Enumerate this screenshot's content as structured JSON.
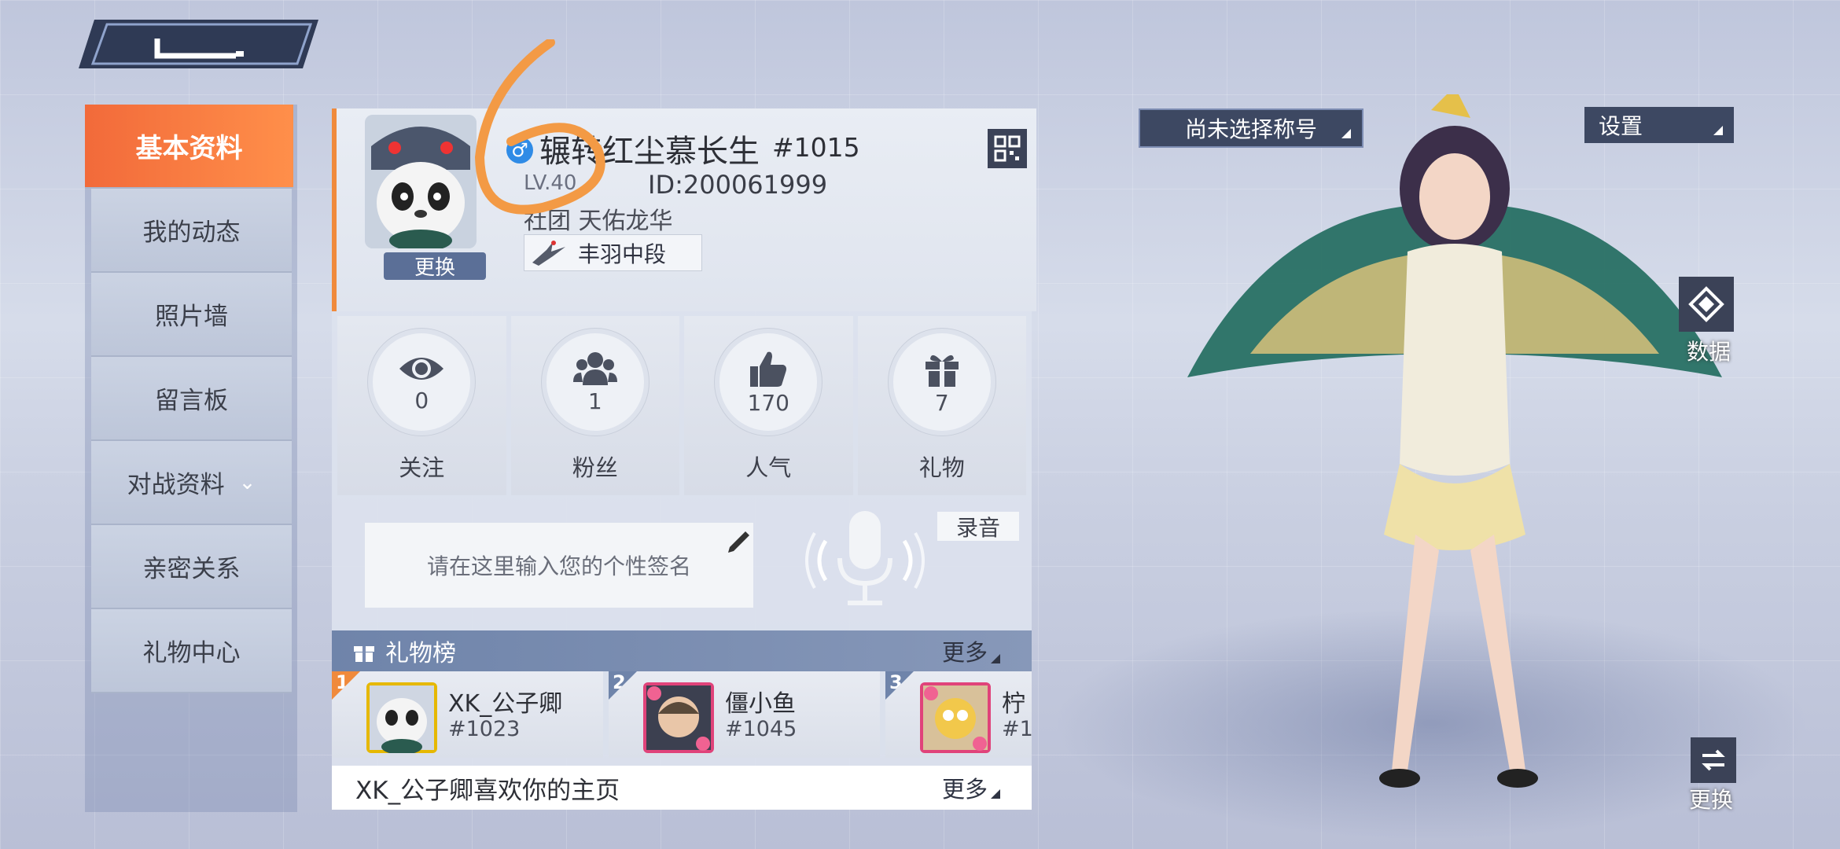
{
  "nav": {
    "items": [
      {
        "label": "基本资料",
        "active": true
      },
      {
        "label": "我的动态"
      },
      {
        "label": "照片墙"
      },
      {
        "label": "留言板"
      },
      {
        "label": "对战资料",
        "has_chevron": true
      },
      {
        "label": "亲密关系"
      },
      {
        "label": "礼物中心"
      }
    ]
  },
  "profile": {
    "change_label": "更换",
    "gender": "♂",
    "name": "辗转红尘慕长生",
    "tag": "#1015",
    "level": "LV.40",
    "id": "ID:200061999",
    "club": "社团 天佑龙华",
    "rank": "丰羽中段"
  },
  "stats": [
    {
      "label": "关注",
      "count": "0",
      "icon": "eye-icon"
    },
    {
      "label": "粉丝",
      "count": "1",
      "icon": "fans-icon"
    },
    {
      "label": "人气",
      "count": "170",
      "icon": "thumbs-up-icon"
    },
    {
      "label": "礼物",
      "count": "7",
      "icon": "gift-icon"
    }
  ],
  "signature": {
    "placeholder": "请在这里输入您的个性签名",
    "record_label": "录音"
  },
  "gift_ranking": {
    "title": "礼物榜",
    "more_label": "更多",
    "entries": [
      {
        "rank": "1",
        "name": "XK_公子卿",
        "tag": "#1023"
      },
      {
        "rank": "2",
        "name": "僵小鱼",
        "tag": "#1045"
      },
      {
        "rank": "3",
        "name": "柠",
        "tag": "#1"
      }
    ]
  },
  "likes": {
    "text": "XK_公子卿喜欢你的主页",
    "more_label": "更多"
  },
  "right": {
    "title_select": "尚未选择称号",
    "settings": "设置",
    "data_label": "数据",
    "change_label": "更换"
  },
  "colors": {
    "accent": "#f26a3a",
    "panel_dark": "#3d4862",
    "gift_bar": "#7b8db3"
  }
}
